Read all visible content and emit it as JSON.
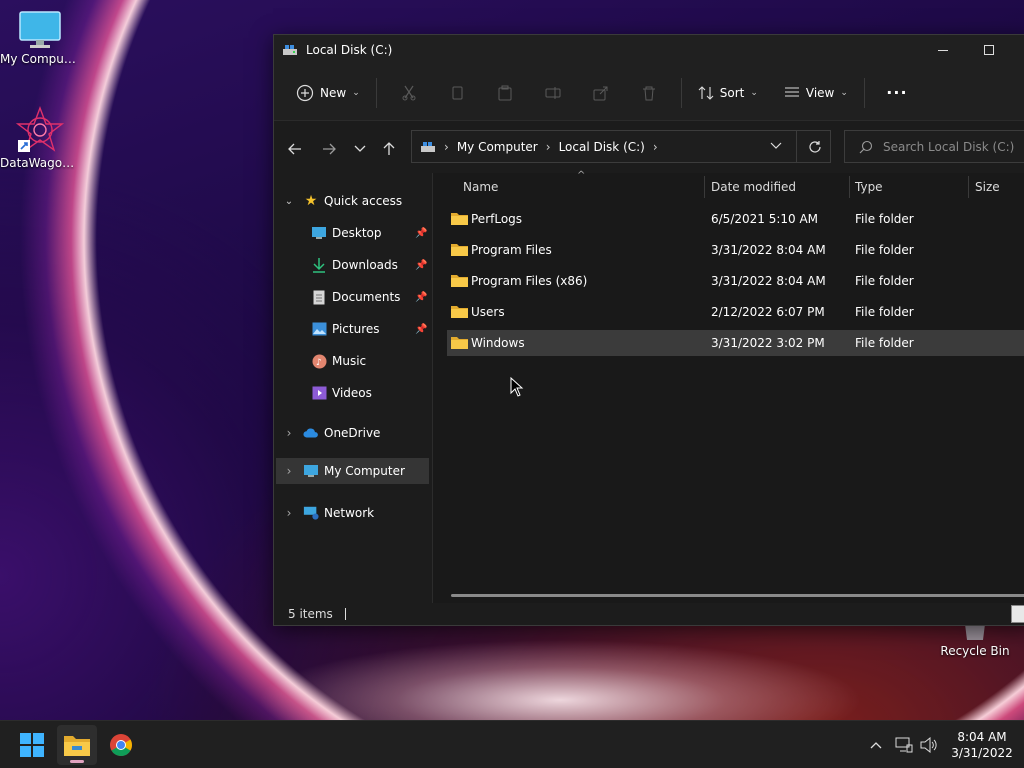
{
  "desktop": {
    "icons": [
      {
        "label": "My Computer"
      },
      {
        "label": "DataWagon..."
      },
      {
        "label": "Recycle Bin"
      }
    ]
  },
  "window": {
    "title": "Local Disk (C:)",
    "toolbar": {
      "new_label": "New",
      "sort_label": "Sort",
      "view_label": "View"
    },
    "address": {
      "crumbs": [
        "My Computer",
        "Local Disk (C:)"
      ]
    },
    "search": {
      "placeholder": "Search Local Disk (C:)"
    },
    "sidebar": {
      "quick_access": "Quick access",
      "items": [
        {
          "label": "Desktop",
          "pinned": true
        },
        {
          "label": "Downloads",
          "pinned": true
        },
        {
          "label": "Documents",
          "pinned": true
        },
        {
          "label": "Pictures",
          "pinned": true
        },
        {
          "label": "Music",
          "pinned": false
        },
        {
          "label": "Videos",
          "pinned": false
        }
      ],
      "onedrive": "OneDrive",
      "my_computer": "My Computer",
      "network": "Network"
    },
    "columns": {
      "name": "Name",
      "date": "Date modified",
      "type": "Type",
      "size": "Size"
    },
    "files": [
      {
        "name": "PerfLogs",
        "date": "6/5/2021 5:10 AM",
        "type": "File folder"
      },
      {
        "name": "Program Files",
        "date": "3/31/2022 8:04 AM",
        "type": "File folder"
      },
      {
        "name": "Program Files (x86)",
        "date": "3/31/2022 8:04 AM",
        "type": "File folder"
      },
      {
        "name": "Users",
        "date": "2/12/2022 6:07 PM",
        "type": "File folder"
      },
      {
        "name": "Windows",
        "date": "3/31/2022 3:02 PM",
        "type": "File folder",
        "selected": true
      }
    ],
    "status": {
      "count": "5 items"
    }
  },
  "taskbar": {
    "time": "8:04 AM",
    "date": "3/31/2022"
  },
  "colors": {
    "accent": "#4cc2ff",
    "folder": "#f8c948",
    "selected_row": "#3b3b3b"
  }
}
